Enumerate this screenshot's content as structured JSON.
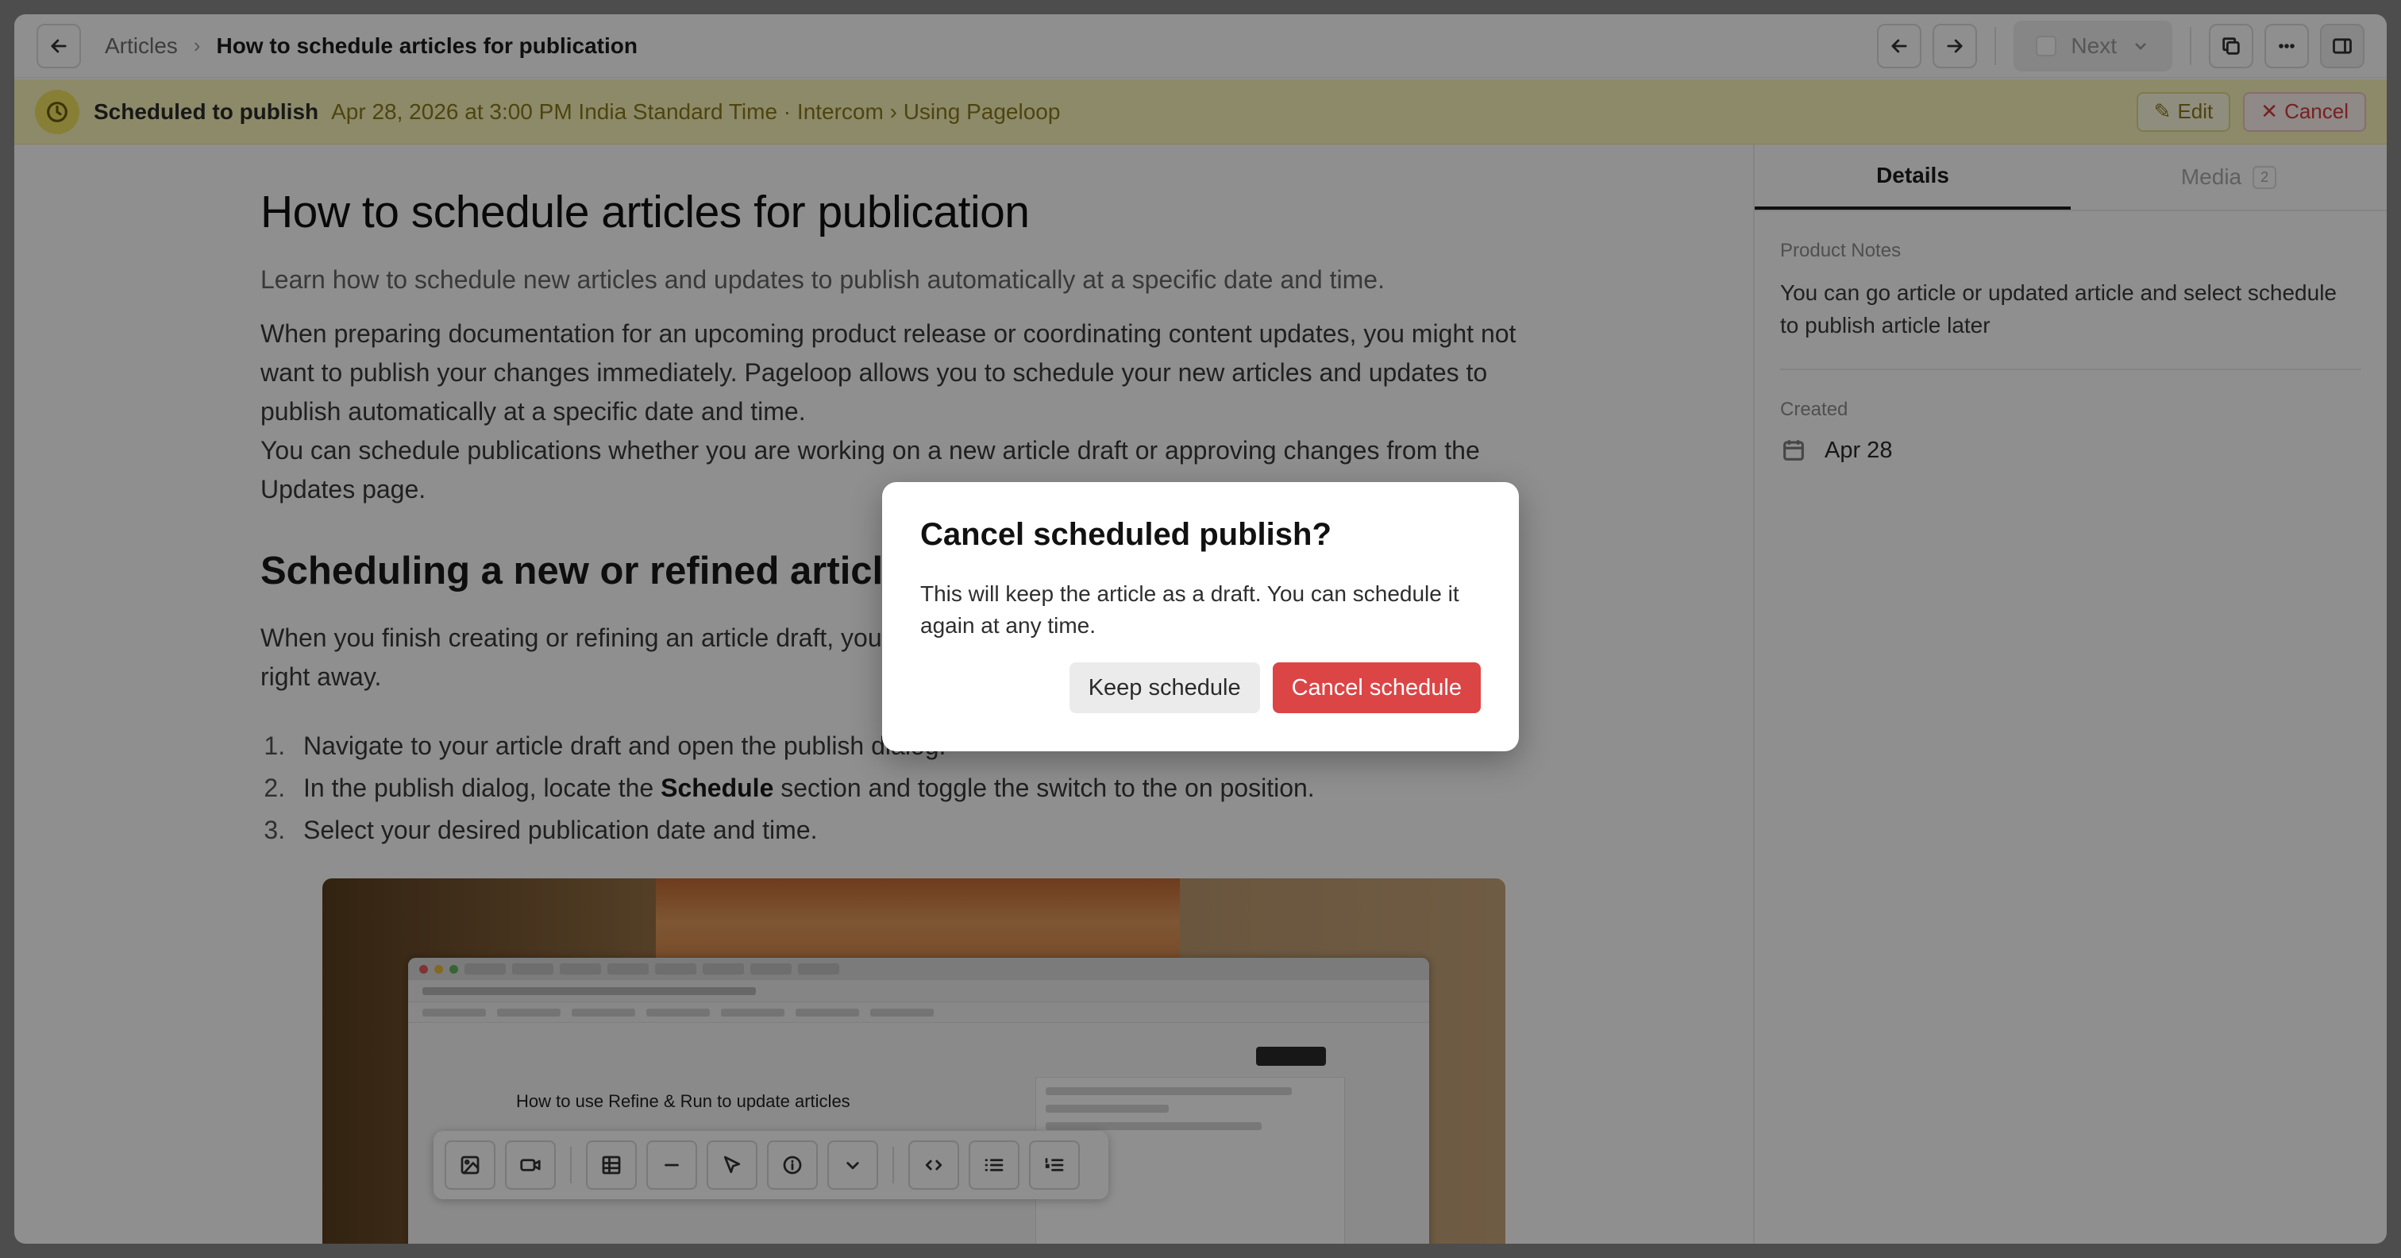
{
  "topbar": {
    "breadcrumb_root": "Articles",
    "breadcrumb_sep": "›",
    "breadcrumb_current": "How to schedule articles for publication",
    "next_label": "Next"
  },
  "banner": {
    "label": "Scheduled to publish",
    "detail": "Apr 28, 2026 at 3:00 PM India Standard Time · Intercom › Using Pageloop",
    "edit_label": "Edit",
    "cancel_label": "Cancel",
    "color": "#fbf6bc"
  },
  "article": {
    "title": "How to schedule articles for publication",
    "subtitle": "Learn how to schedule new articles and updates to publish automatically at a specific date and time.",
    "para1_line1": "When preparing documentation for an upcoming product release or coordinating content updates, you might not want to publish your changes immediately. Pageloop allows you to schedule your new articles and updates to publish automatically at a specific date and time.",
    "para1_line2": "You can schedule publications whether you are working on a new article draft or approving changes from the Updates page.",
    "h2": "Scheduling a new or refined article",
    "para2": "When you finish creating or refining an article draft, you can schedule it for publication instead of publishing it right away.",
    "steps": [
      {
        "before": "Navigate to your article draft and open the publish dialog.",
        "bold": "",
        "after": ""
      },
      {
        "before": "In the publish dialog, locate the ",
        "bold": "Schedule",
        "after": " section and toggle the switch to the on position."
      },
      {
        "before": "Select your desired publication date and time.",
        "bold": "",
        "after": ""
      }
    ],
    "embedded_screenshot_title": "How to use Refine & Run to update articles"
  },
  "editor_toolbar": {
    "icons": [
      "image-icon",
      "video-icon",
      "table-icon",
      "divider-icon",
      "cursor-icon",
      "info-icon",
      "chevron-down-icon",
      "code-icon",
      "bullet-list-icon",
      "numbered-list-icon"
    ]
  },
  "sidebar": {
    "tab_details": "Details",
    "tab_media": "Media",
    "media_count": "2",
    "notes_label": "Product Notes",
    "notes_text": "You can go article or updated article and select schedule to publish article later",
    "created_label": "Created",
    "created_value": "Apr 28"
  },
  "modal": {
    "title": "Cancel scheduled publish?",
    "body": "This will keep the article as a draft. You can schedule it again at any time.",
    "keep_label": "Keep schedule",
    "confirm_label": "Cancel schedule",
    "confirm_color": "#dc4545"
  }
}
